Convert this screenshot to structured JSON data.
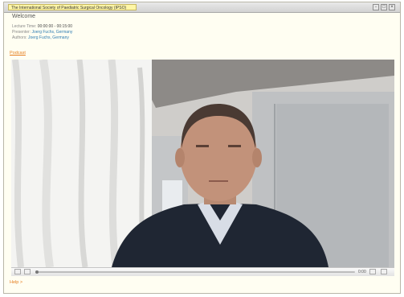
{
  "window": {
    "title": "The International Society of Paediatric Surgical Oncology (IPSO)"
  },
  "lecture": {
    "heading": "Welcome",
    "time_label": "Lecture Time:",
    "time_value": "00:00:00 - 00:15:00",
    "presenter_label": "Presenter:",
    "presenter_value": "Joerg Fuchs, Germany",
    "authors_label": "Authors:",
    "authors_value": "Joerg Fuchs, Germany"
  },
  "links": {
    "podcast": "Podcast",
    "help": "Help >"
  },
  "player": {
    "elapsed": "0:00",
    "controls": [
      "play-icon",
      "volume-icon",
      "fullscreen-icon",
      "settings-icon"
    ]
  },
  "colors": {
    "accent": "#e57d1e",
    "link": "#2f7db2",
    "window_bg": "#fffef2"
  }
}
